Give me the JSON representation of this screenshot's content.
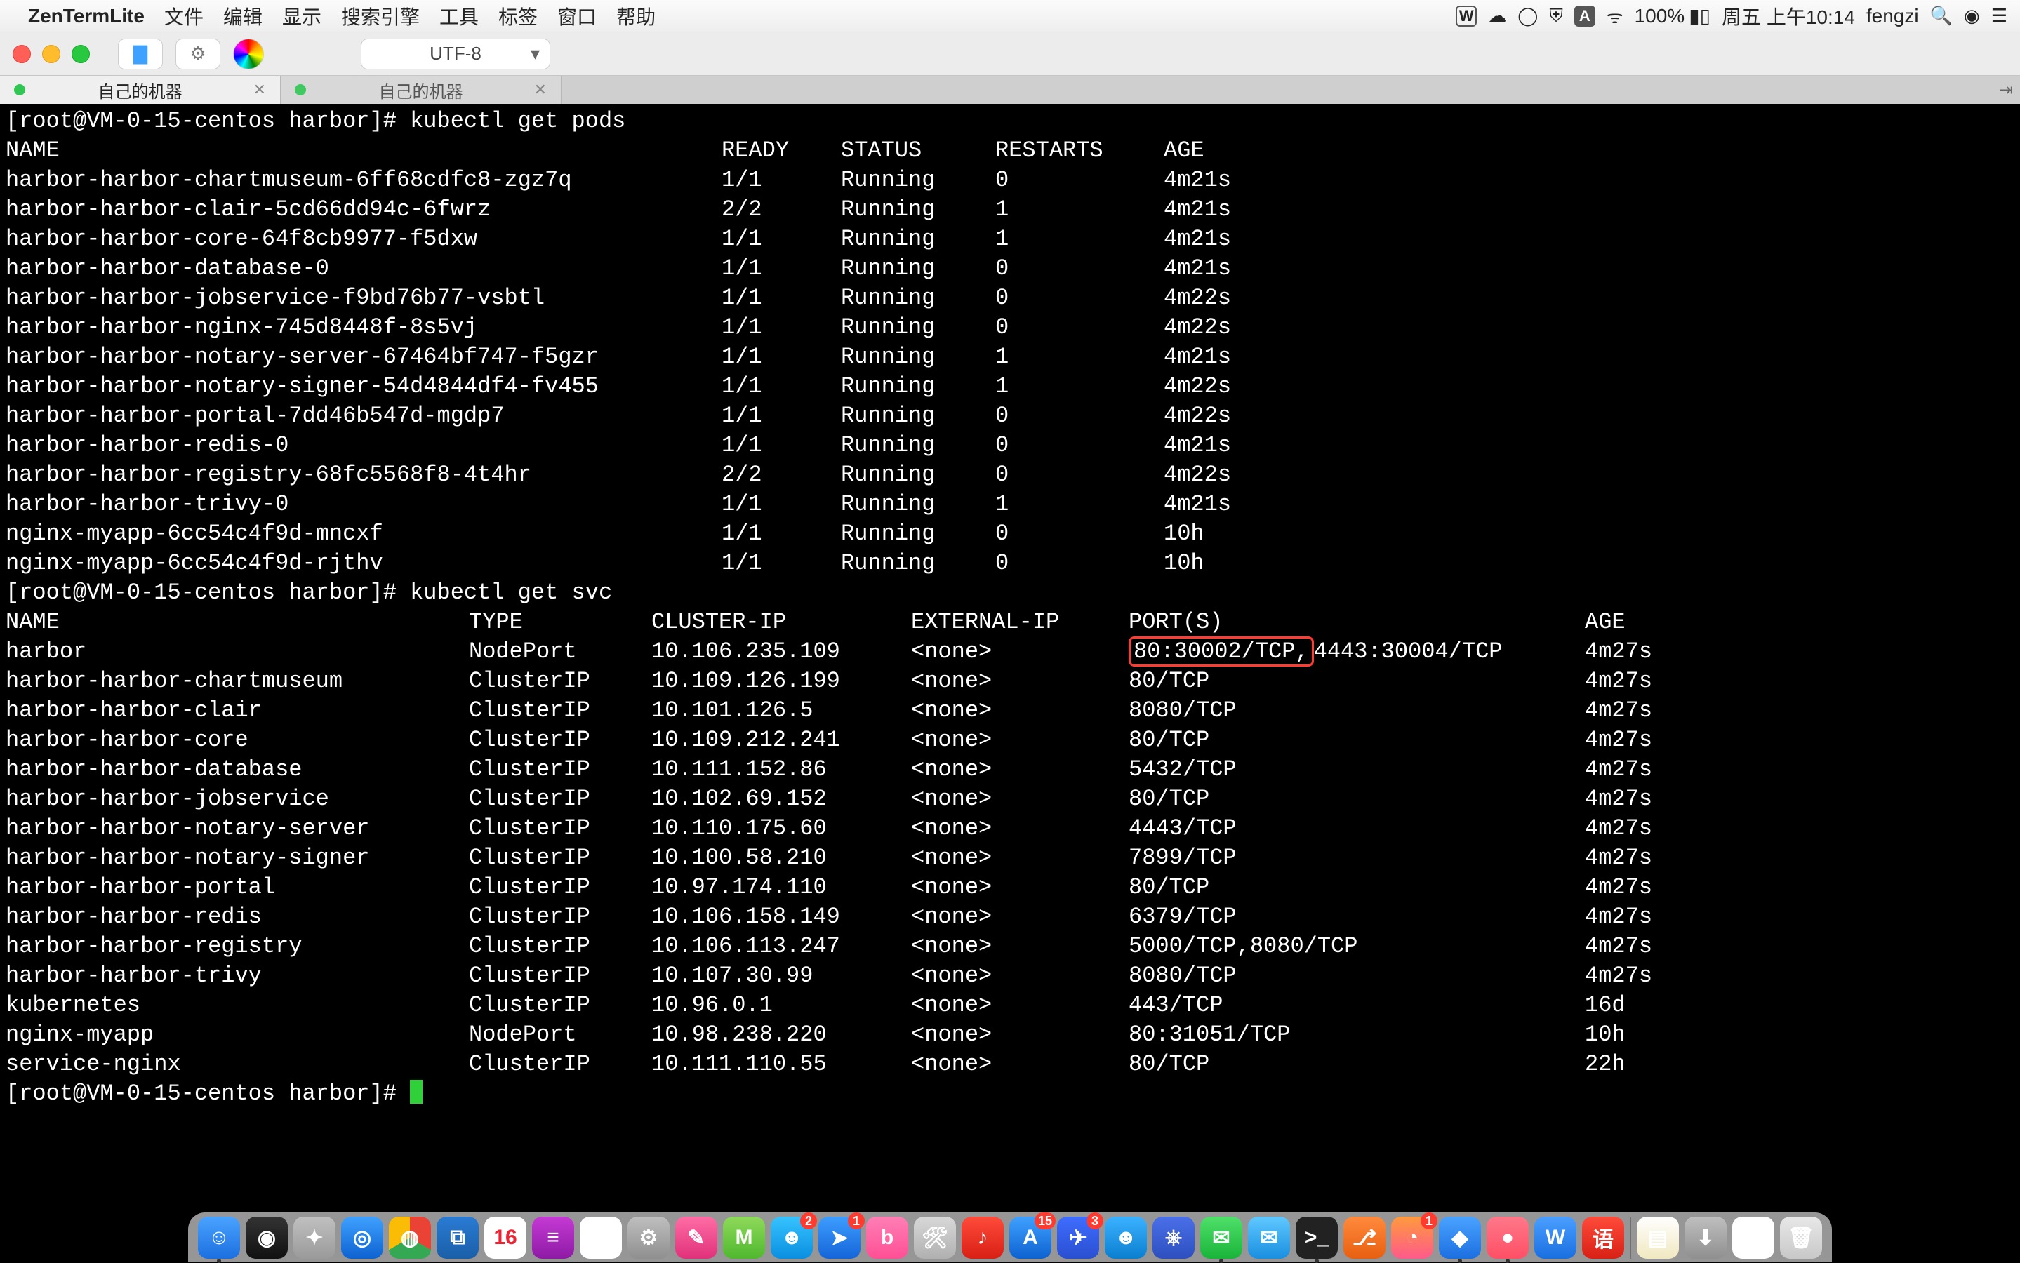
{
  "menubar": {
    "appname": "ZenTermLite",
    "items": [
      "文件",
      "编辑",
      "显示",
      "搜索引擎",
      "工具",
      "标签",
      "窗口",
      "帮助"
    ],
    "battery": "100%",
    "clock": "周五 上午10:14",
    "user": "fengzi"
  },
  "toolbar": {
    "encoding": "UTF-8"
  },
  "tabs": [
    {
      "title": "自己的机器",
      "active": true
    },
    {
      "title": "自己的机器",
      "active": false
    }
  ],
  "terminal": {
    "prompt1": "[root@VM-0-15-centos harbor]# ",
    "cmd1": "kubectl get pods",
    "pods_header": {
      "name": "NAME",
      "ready": "READY",
      "status": "STATUS",
      "restarts": "RESTARTS",
      "age": "AGE"
    },
    "pods": [
      {
        "name": "harbor-harbor-chartmuseum-6ff68cdfc8-zgz7q",
        "ready": "1/1",
        "status": "Running",
        "restarts": "0",
        "age": "4m21s"
      },
      {
        "name": "harbor-harbor-clair-5cd66dd94c-6fwrz",
        "ready": "2/2",
        "status": "Running",
        "restarts": "1",
        "age": "4m21s"
      },
      {
        "name": "harbor-harbor-core-64f8cb9977-f5dxw",
        "ready": "1/1",
        "status": "Running",
        "restarts": "1",
        "age": "4m21s"
      },
      {
        "name": "harbor-harbor-database-0",
        "ready": "1/1",
        "status": "Running",
        "restarts": "0",
        "age": "4m21s"
      },
      {
        "name": "harbor-harbor-jobservice-f9bd76b77-vsbtl",
        "ready": "1/1",
        "status": "Running",
        "restarts": "0",
        "age": "4m22s"
      },
      {
        "name": "harbor-harbor-nginx-745d8448f-8s5vj",
        "ready": "1/1",
        "status": "Running",
        "restarts": "0",
        "age": "4m22s"
      },
      {
        "name": "harbor-harbor-notary-server-67464bf747-f5gzr",
        "ready": "1/1",
        "status": "Running",
        "restarts": "1",
        "age": "4m21s"
      },
      {
        "name": "harbor-harbor-notary-signer-54d4844df4-fv455",
        "ready": "1/1",
        "status": "Running",
        "restarts": "1",
        "age": "4m22s"
      },
      {
        "name": "harbor-harbor-portal-7dd46b547d-mgdp7",
        "ready": "1/1",
        "status": "Running",
        "restarts": "0",
        "age": "4m22s"
      },
      {
        "name": "harbor-harbor-redis-0",
        "ready": "1/1",
        "status": "Running",
        "restarts": "0",
        "age": "4m21s"
      },
      {
        "name": "harbor-harbor-registry-68fc5568f8-4t4hr",
        "ready": "2/2",
        "status": "Running",
        "restarts": "0",
        "age": "4m22s"
      },
      {
        "name": "harbor-harbor-trivy-0",
        "ready": "1/1",
        "status": "Running",
        "restarts": "1",
        "age": "4m21s"
      },
      {
        "name": "nginx-myapp-6cc54c4f9d-mncxf",
        "ready": "1/1",
        "status": "Running",
        "restarts": "0",
        "age": "10h"
      },
      {
        "name": "nginx-myapp-6cc54c4f9d-rjthv",
        "ready": "1/1",
        "status": "Running",
        "restarts": "0",
        "age": "10h"
      }
    ],
    "prompt2": "[root@VM-0-15-centos harbor]# ",
    "cmd2": "kubectl get svc",
    "svc_header": {
      "name": "NAME",
      "type": "TYPE",
      "cip": "CLUSTER-IP",
      "eip": "EXTERNAL-IP",
      "ports": "PORT(S)",
      "age": "AGE"
    },
    "svc": [
      {
        "name": "harbor",
        "type": "NodePort",
        "cip": "10.106.235.109",
        "eip": "<none>",
        "ports_hl": "80:30002/TCP,",
        "ports_tail": "4443:30004/TCP",
        "age": "4m27s"
      },
      {
        "name": "harbor-harbor-chartmuseum",
        "type": "ClusterIP",
        "cip": "10.109.126.199",
        "eip": "<none>",
        "ports": "80/TCP",
        "age": "4m27s"
      },
      {
        "name": "harbor-harbor-clair",
        "type": "ClusterIP",
        "cip": "10.101.126.5",
        "eip": "<none>",
        "ports": "8080/TCP",
        "age": "4m27s"
      },
      {
        "name": "harbor-harbor-core",
        "type": "ClusterIP",
        "cip": "10.109.212.241",
        "eip": "<none>",
        "ports": "80/TCP",
        "age": "4m27s"
      },
      {
        "name": "harbor-harbor-database",
        "type": "ClusterIP",
        "cip": "10.111.152.86",
        "eip": "<none>",
        "ports": "5432/TCP",
        "age": "4m27s"
      },
      {
        "name": "harbor-harbor-jobservice",
        "type": "ClusterIP",
        "cip": "10.102.69.152",
        "eip": "<none>",
        "ports": "80/TCP",
        "age": "4m27s"
      },
      {
        "name": "harbor-harbor-notary-server",
        "type": "ClusterIP",
        "cip": "10.110.175.60",
        "eip": "<none>",
        "ports": "4443/TCP",
        "age": "4m27s"
      },
      {
        "name": "harbor-harbor-notary-signer",
        "type": "ClusterIP",
        "cip": "10.100.58.210",
        "eip": "<none>",
        "ports": "7899/TCP",
        "age": "4m27s"
      },
      {
        "name": "harbor-harbor-portal",
        "type": "ClusterIP",
        "cip": "10.97.174.110",
        "eip": "<none>",
        "ports": "80/TCP",
        "age": "4m27s"
      },
      {
        "name": "harbor-harbor-redis",
        "type": "ClusterIP",
        "cip": "10.106.158.149",
        "eip": "<none>",
        "ports": "6379/TCP",
        "age": "4m27s"
      },
      {
        "name": "harbor-harbor-registry",
        "type": "ClusterIP",
        "cip": "10.106.113.247",
        "eip": "<none>",
        "ports": "5000/TCP,8080/TCP",
        "age": "4m27s"
      },
      {
        "name": "harbor-harbor-trivy",
        "type": "ClusterIP",
        "cip": "10.107.30.99",
        "eip": "<none>",
        "ports": "8080/TCP",
        "age": "4m27s"
      },
      {
        "name": "kubernetes",
        "type": "ClusterIP",
        "cip": "10.96.0.1",
        "eip": "<none>",
        "ports": "443/TCP",
        "age": "16d"
      },
      {
        "name": "nginx-myapp",
        "type": "NodePort",
        "cip": "10.98.238.220",
        "eip": "<none>",
        "ports": "80:31051/TCP",
        "age": "10h"
      },
      {
        "name": "service-nginx",
        "type": "ClusterIP",
        "cip": "10.111.110.55",
        "eip": "<none>",
        "ports": "80/TCP",
        "age": "22h"
      }
    ],
    "prompt3": "[root@VM-0-15-centos harbor]# "
  },
  "dock": {
    "apps": [
      {
        "name": "finder",
        "glyph": "☺",
        "bg": "linear-gradient(#4aa3ff,#1c6fe0)",
        "ind": true
      },
      {
        "name": "siri",
        "glyph": "◉",
        "bg": "linear-gradient(#333,#111)"
      },
      {
        "name": "launchpad",
        "glyph": "✦",
        "bg": "linear-gradient(#c0c0c0,#9a9a9a)"
      },
      {
        "name": "safari",
        "glyph": "◎",
        "bg": "linear-gradient(#3fa1ff,#0d62d0)"
      },
      {
        "name": "chrome",
        "glyph": "◍",
        "bg": "conic-gradient(#ea4335 0 120deg,#34a853 120deg 240deg,#fbbc05 240deg 360deg)"
      },
      {
        "name": "vscode",
        "glyph": "⧉",
        "bg": "linear-gradient(#2a7bd4,#1a5fa8)"
      },
      {
        "name": "calendar",
        "glyph": "16",
        "bg": "#fff",
        "col": "#e23",
        "ind": false,
        "badge": ""
      },
      {
        "name": "dash",
        "glyph": "≡",
        "bg": "linear-gradient(#c53ad4,#8e1aa5)"
      },
      {
        "name": "photos",
        "glyph": "✿",
        "bg": "#fff"
      },
      {
        "name": "settings",
        "glyph": "⚙",
        "bg": "linear-gradient(#bfbfbf,#8f8f8f)"
      },
      {
        "name": "notability",
        "glyph": "✎",
        "bg": "linear-gradient(#ff6da5,#e0317a)"
      },
      {
        "name": "marginnote",
        "glyph": "M",
        "bg": "linear-gradient(#8fd95b,#4fb82e)"
      },
      {
        "name": "qq",
        "glyph": "☻",
        "bg": "linear-gradient(#36c3ff,#0a8fe0)",
        "badge": "2"
      },
      {
        "name": "dingtalk",
        "glyph": "➤",
        "bg": "linear-gradient(#3d9dff,#1565d8)",
        "badge": "1"
      },
      {
        "name": "bilibili",
        "glyph": "b",
        "bg": "linear-gradient(#ff7fb5,#ff4f95)"
      },
      {
        "name": "hammer",
        "glyph": "🛠",
        "bg": "linear-gradient(#d8d8d8,#b0b0b0)"
      },
      {
        "name": "netease",
        "glyph": "♪",
        "bg": "linear-gradient(#ff4b3a,#d82015)"
      },
      {
        "name": "appstore",
        "glyph": "A",
        "bg": "linear-gradient(#3fa1ff,#0d62d0)",
        "badge": "15"
      },
      {
        "name": "feishu",
        "glyph": "✈",
        "bg": "linear-gradient(#3f6dff,#2a4fd0)",
        "badge": "3"
      },
      {
        "name": "aliwang",
        "glyph": "☻",
        "bg": "linear-gradient(#3bb2ff,#0a7fd0)"
      },
      {
        "name": "kubernetes",
        "glyph": "⎈",
        "bg": "linear-gradient(#4a6fe8,#2d4fbf)"
      },
      {
        "name": "wechat",
        "glyph": "✉",
        "bg": "linear-gradient(#4fe06a,#1ab43a)",
        "ind": true
      },
      {
        "name": "mail",
        "glyph": "✉",
        "bg": "linear-gradient(#5fc8ff,#1a8fe0)"
      },
      {
        "name": "terminal",
        "glyph": ">_",
        "bg": "#222",
        "ind": true
      },
      {
        "name": "git",
        "glyph": "⎇",
        "bg": "linear-gradient(#ff8a3d,#e85f10)"
      },
      {
        "name": "cleanmymac",
        "glyph": "◔",
        "bg": "linear-gradient(#ff9a3d,#ff5a8a)",
        "badge": "1"
      },
      {
        "name": "unknown-blue",
        "glyph": "◆",
        "bg": "linear-gradient(#4aa3ff,#1c6fe0)",
        "ind": true
      },
      {
        "name": "monday",
        "glyph": "●",
        "bg": "linear-gradient(#ff788a,#ff4f65)",
        "ind": true
      },
      {
        "name": "wps",
        "glyph": "W",
        "bg": "linear-gradient(#4a9fff,#1a6fe0)"
      },
      {
        "name": "dictionary",
        "glyph": "语",
        "bg": "linear-gradient(#ff4b3a,#d82015)"
      },
      {
        "name": "sep",
        "sep": true
      },
      {
        "name": "notes",
        "glyph": "▤",
        "bg": "linear-gradient(#fff,#f0e8c0)"
      },
      {
        "name": "downloads",
        "glyph": "⬇",
        "bg": "linear-gradient(#bfbfbf,#8f8f8f)"
      },
      {
        "name": "lark-doc",
        "glyph": "▤",
        "bg": "#fff"
      },
      {
        "name": "trash",
        "glyph": "🗑",
        "bg": "linear-gradient(#e8e8e8,#c8c8c8)"
      }
    ]
  }
}
